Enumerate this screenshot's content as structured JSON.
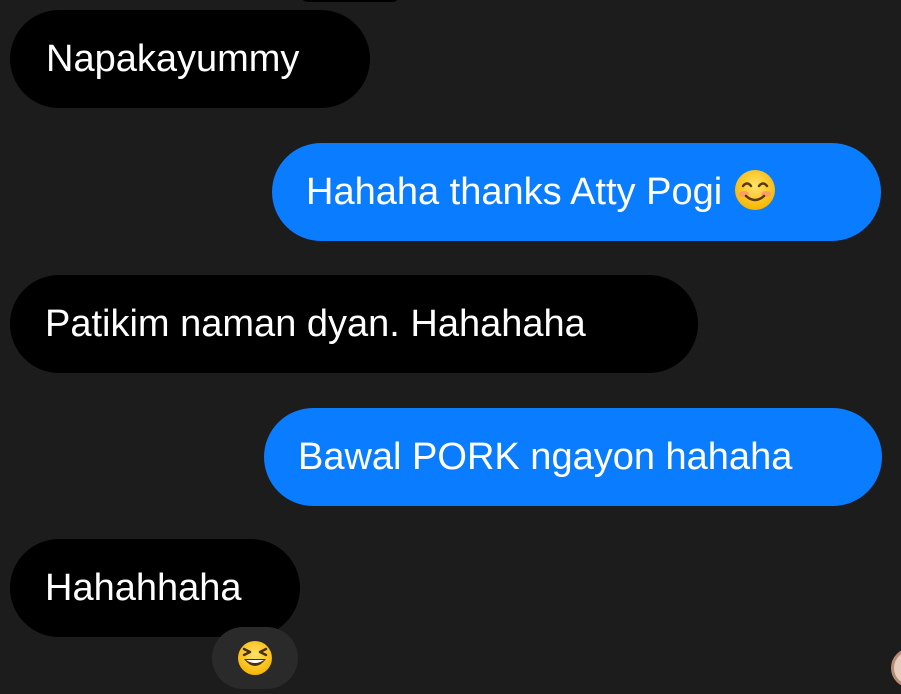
{
  "messages": [
    {
      "text": "Napakayummy",
      "direction": "incoming"
    },
    {
      "text": "Hahaha thanks Atty Pogi",
      "emoji": "smiling-face-icon",
      "direction": "outgoing"
    },
    {
      "text": "Patikim naman dyan. Hahahaha",
      "direction": "incoming"
    },
    {
      "text": "Bawal PORK ngayon hahaha",
      "direction": "outgoing"
    },
    {
      "text": "Hahahhaha",
      "direction": "incoming",
      "reaction": "grinning-squinting-face-icon"
    }
  ],
  "colors": {
    "background": "#1c1c1d",
    "incoming_bubble": "#000000",
    "outgoing_bubble": "#0a7cff",
    "text": "#ffffff"
  }
}
